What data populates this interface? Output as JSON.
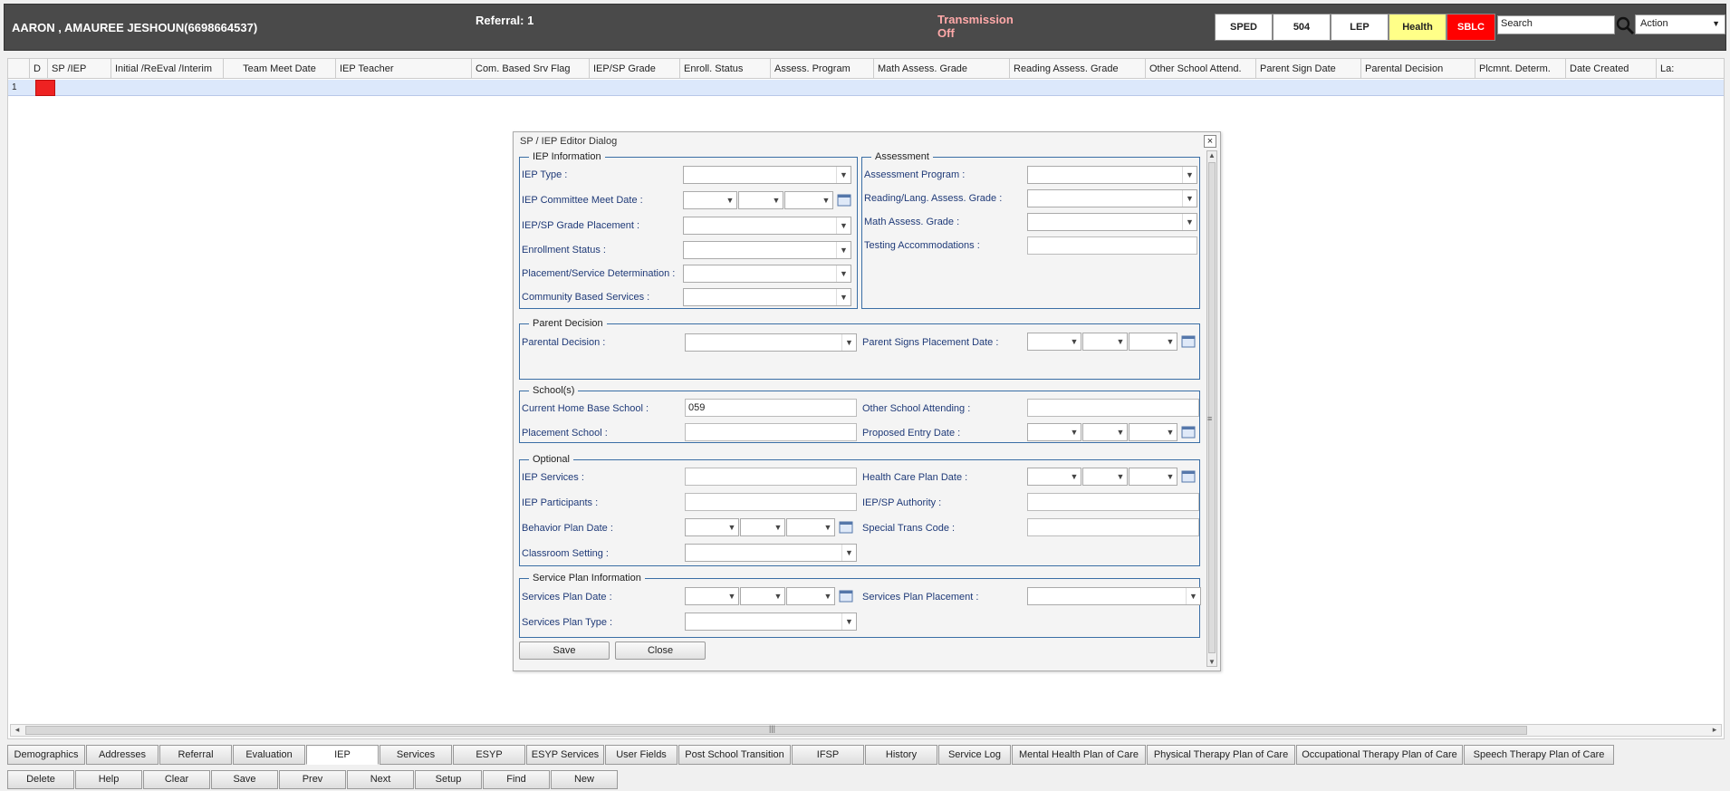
{
  "header": {
    "student": "AARON , AMAUREE JESHOUN(6698664537)",
    "referral": "Referral: 1",
    "transmission_line1": "Transmission",
    "transmission_line2": "Off",
    "flags": {
      "sped": "SPED",
      "s504": "504",
      "lep": "LEP",
      "health": "Health",
      "sblc": "SBLC"
    },
    "flag_colors": {
      "health": "#ffff88",
      "sblc": "#ff0000"
    },
    "search_placeholder": "Search",
    "action_label": "Action"
  },
  "grid": {
    "columns": [
      "",
      "D",
      "SP /IEP",
      "Initial /ReEval /Interim",
      "Team Meet Date",
      "IEP Teacher",
      "Com. Based Srv Flag",
      "IEP/SP Grade",
      "Enroll. Status",
      "Assess. Program",
      "Math Assess. Grade",
      "Reading Assess. Grade",
      "Other School Attend.",
      "Parent Sign Date",
      "Parental Decision",
      "Plcmnt. Determ.",
      "Date Created",
      "La:"
    ],
    "row_number": "1"
  },
  "dialog": {
    "title": "SP / IEP Editor Dialog",
    "iep_info": {
      "legend": "IEP Information",
      "iep_type": "IEP Type :",
      "committee_meet_date": "IEP Committee Meet Date :",
      "grade_placement": "IEP/SP Grade Placement :",
      "enrollment_status": "Enrollment Status :",
      "placement_determination": "Placement/Service Determination :",
      "community_services": "Community Based Services :"
    },
    "assessment": {
      "legend": "Assessment",
      "program": "Assessment Program :",
      "reading_grade": "Reading/Lang. Assess. Grade :",
      "math_grade": "Math Assess. Grade :",
      "testing_accommodations": "Testing Accommodations :"
    },
    "parent_decision": {
      "legend": "Parent Decision",
      "parental_decision": "Parental Decision :",
      "parent_signs_date": "Parent Signs Placement Date :"
    },
    "schools": {
      "legend": "School(s)",
      "home_base": "Current Home Base School :",
      "home_base_value": "059",
      "other_attending": "Other School Attending :",
      "placement_school": "Placement School :",
      "proposed_entry": "Proposed Entry Date :"
    },
    "optional": {
      "legend": "Optional",
      "iep_services": "IEP Services :",
      "health_care_plan_date": "Health Care Plan Date :",
      "iep_participants": "IEP Participants :",
      "authority": "IEP/SP Authority :",
      "behavior_plan_date": "Behavior Plan Date :",
      "special_trans_code": "Special Trans Code :",
      "classroom_setting": "Classroom Setting :"
    },
    "service_plan": {
      "legend": "Service Plan Information",
      "plan_date": "Services Plan Date :",
      "plan_placement": "Services Plan Placement :",
      "plan_type": "Services Plan Type :"
    },
    "save": "Save",
    "close": "Close"
  },
  "tabs": [
    "Demographics",
    "Addresses",
    "Referral",
    "Evaluation",
    "IEP",
    "Services",
    "ESYP",
    "ESYP Services",
    "User Fields",
    "Post School Transition",
    "IFSP",
    "History",
    "Service Log",
    "Mental Health Plan of Care",
    "Physical Therapy Plan of Care",
    "Occupational Therapy Plan of Care",
    "Speech Therapy Plan of Care"
  ],
  "active_tab": "IEP",
  "buttons": [
    "Delete",
    "Help",
    "Clear",
    "Save",
    "Prev",
    "Next",
    "Setup",
    "Find",
    "New"
  ]
}
